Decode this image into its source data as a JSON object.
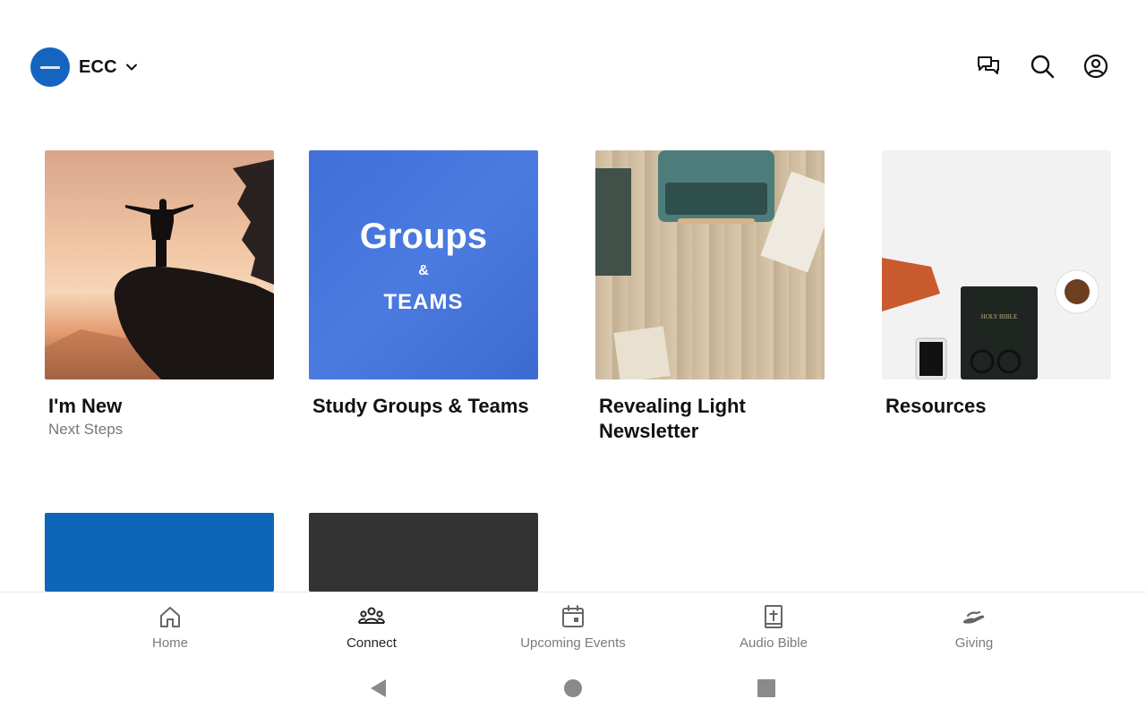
{
  "header": {
    "church_name": "ECC",
    "icons": [
      "chat-icon",
      "search-icon",
      "account-icon"
    ]
  },
  "cards": [
    {
      "title": "I'm New",
      "subtitle": "Next Steps"
    },
    {
      "title": "Study Groups & Teams",
      "subtitle": "",
      "image_text": {
        "line1": "Groups",
        "line2": "&",
        "line3": "TEAMS"
      }
    },
    {
      "title": "Revealing Light Newsletter",
      "subtitle": ""
    },
    {
      "title": "Resources",
      "subtitle": "",
      "image_text": {
        "book": "HOLY BIBLE"
      }
    },
    {
      "title": "",
      "subtitle": ""
    },
    {
      "title": "",
      "subtitle": ""
    }
  ],
  "bottom_nav": {
    "items": [
      {
        "label": "Home",
        "icon": "home-icon"
      },
      {
        "label": "Connect",
        "icon": "people-icon",
        "active": true
      },
      {
        "label": "Upcoming Events",
        "icon": "calendar-icon"
      },
      {
        "label": "Audio Bible",
        "icon": "bible-icon"
      },
      {
        "label": "Giving",
        "icon": "giving-hand-icon"
      }
    ]
  },
  "colors": {
    "brand_blue": "#1565c0",
    "groups_blue": "#4477dd",
    "dark_tile": "#333333",
    "muted_text": "#777777"
  }
}
